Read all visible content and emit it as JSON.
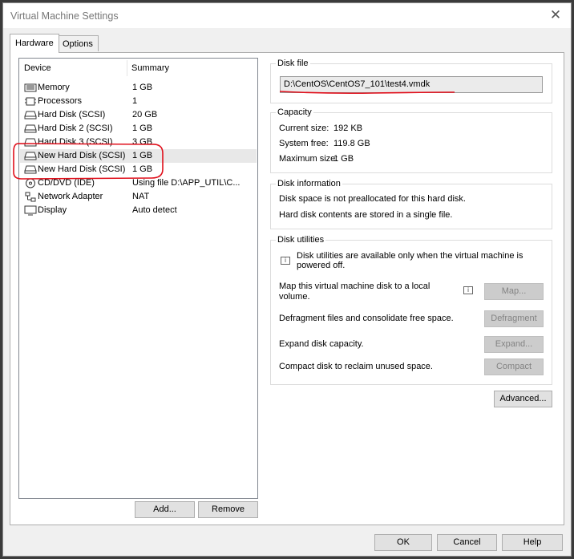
{
  "window": {
    "title": "Virtual Machine Settings"
  },
  "tabs": [
    {
      "label": "Hardware"
    },
    {
      "label": "Options"
    }
  ],
  "device_list": {
    "headers": {
      "device": "Device",
      "summary": "Summary"
    },
    "rows": [
      {
        "name": "Memory",
        "summary": "1 GB",
        "icon": "memory-icon"
      },
      {
        "name": "Processors",
        "summary": "1",
        "icon": "processor-icon"
      },
      {
        "name": "Hard Disk (SCSI)",
        "summary": "20 GB",
        "icon": "hard-disk-icon"
      },
      {
        "name": "Hard Disk 2 (SCSI)",
        "summary": "1 GB",
        "icon": "hard-disk-icon"
      },
      {
        "name": "Hard Disk 3 (SCSI)",
        "summary": "3 GB",
        "icon": "hard-disk-icon"
      },
      {
        "name": "New Hard Disk (SCSI)",
        "summary": "1 GB",
        "icon": "hard-disk-icon"
      },
      {
        "name": "New Hard Disk (SCSI)",
        "summary": "1 GB",
        "icon": "hard-disk-icon"
      },
      {
        "name": "CD/DVD (IDE)",
        "summary": "Using file D:\\APP_UTIL\\C...",
        "icon": "cd-dvd-icon"
      },
      {
        "name": "Network Adapter",
        "summary": "NAT",
        "icon": "network-adapter-icon"
      },
      {
        "name": "Display",
        "summary": "Auto detect",
        "icon": "display-icon"
      }
    ],
    "add_label": "Add...",
    "remove_label": "Remove"
  },
  "disk_file": {
    "title": "Disk file",
    "path": "D:\\CentOS\\CentOS7_101\\test4.vmdk"
  },
  "capacity": {
    "title": "Capacity",
    "current_label": "Current size:",
    "current_value": "192 KB",
    "free_label": "System free:",
    "free_value": "119.8 GB",
    "max_label": "Maximum size:",
    "max_value": "1 GB"
  },
  "disk_information": {
    "title": "Disk information",
    "line1": "Disk space is not preallocated for this hard disk.",
    "line2": "Hard disk contents are stored in a single file."
  },
  "disk_utilities": {
    "title": "Disk utilities",
    "notice_line1": "Disk utilities are available only when the virtual machine is",
    "notice_line2": "powered off.",
    "map_line1": "Map this virtual machine disk to a local",
    "map_line2": "volume.",
    "map_button": "Map...",
    "defrag_text": "Defragment files and consolidate free space.",
    "defrag_button": "Defragment",
    "expand_text": "Expand disk capacity.",
    "expand_button": "Expand...",
    "compact_text": "Compact disk to reclaim unused space.",
    "compact_button": "Compact"
  },
  "advanced_label": "Advanced...",
  "footer": {
    "ok": "OK",
    "cancel": "Cancel",
    "help": "Help"
  },
  "colors": {
    "annotation_red": "#e0101c",
    "selection": "#e8e8e8"
  }
}
